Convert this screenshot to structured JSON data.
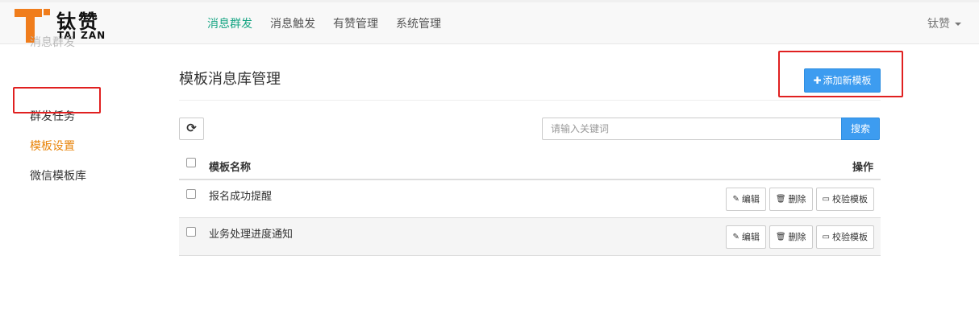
{
  "brand": {
    "name_cn": "钛赞",
    "name_en": "TAI ZAN",
    "accent_color": "#f07d1c"
  },
  "nav": {
    "items": [
      {
        "label": "消息群发",
        "active": true
      },
      {
        "label": "消息触发",
        "active": false
      },
      {
        "label": "有赞管理",
        "active": false
      },
      {
        "label": "系统管理",
        "active": false
      }
    ],
    "active_color": "#19a685"
  },
  "user": {
    "name": "钛赞",
    "icon": "caret-down-icon"
  },
  "sidebar": {
    "heading": "消息群发",
    "items": [
      {
        "label": "群发任务",
        "active": false
      },
      {
        "label": "模板设置",
        "active": true
      },
      {
        "label": "微信模板库",
        "active": false
      }
    ],
    "active_color": "#e8850c"
  },
  "main": {
    "title": "模板消息库管理",
    "add_button": {
      "label": "添加新模板",
      "icon": "plus-icon"
    },
    "refresh_icon": "refresh-icon",
    "search": {
      "placeholder": "请输入关键词",
      "value": "",
      "button_label": "搜索"
    },
    "table": {
      "columns": {
        "name": "模板名称",
        "ops": "操作"
      },
      "rows": [
        {
          "name": "报名成功提醒"
        },
        {
          "name": "业务处理进度通知"
        }
      ],
      "row_actions": [
        {
          "label": "编辑",
          "icon": "edit-icon"
        },
        {
          "label": "删除",
          "icon": "trash-icon"
        },
        {
          "label": "校验模板",
          "icon": "card-icon"
        }
      ]
    },
    "button_color": "#3d9cf0",
    "highlight_color": "#e02020"
  }
}
